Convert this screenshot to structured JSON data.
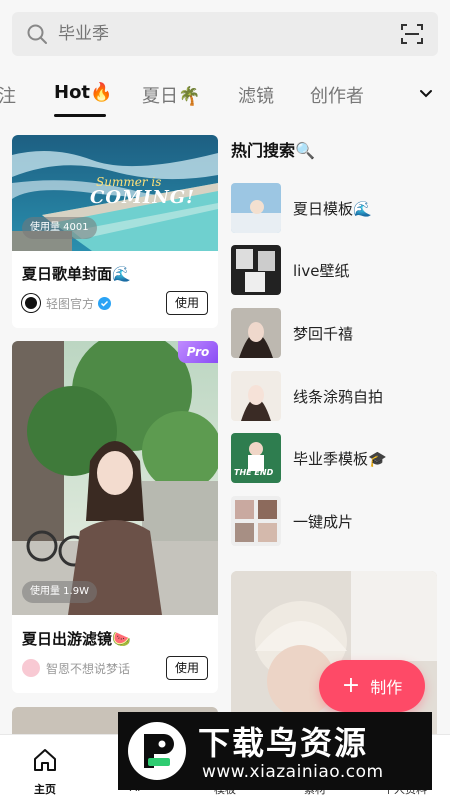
{
  "search": {
    "placeholder": "毕业季"
  },
  "tabs": [
    {
      "label": "注"
    },
    {
      "label": "Hot🔥"
    },
    {
      "label": "夏日🌴"
    },
    {
      "label": "滤镜"
    },
    {
      "label": "创作者"
    }
  ],
  "feed": {
    "cards": [
      {
        "usage": "使用量 4001",
        "title": "夏日歌单封面🌊",
        "author": "轻图官方",
        "button": "使用",
        "image_text_1": "Summer is",
        "image_text_2": "COMING!"
      },
      {
        "badge": "Pro",
        "usage": "使用量 1.9W",
        "title": "夏日出游滤镜🍉",
        "author": "智恩不想说梦话",
        "button": "使用"
      }
    ]
  },
  "hot_search": {
    "title": "热门搜索🔍",
    "items": [
      {
        "label": "夏日模板🌊"
      },
      {
        "label": "live壁纸"
      },
      {
        "label": "梦回千禧"
      },
      {
        "label": "线条涂鸦自拍"
      },
      {
        "label": "毕业季模板🎓",
        "thumb_text": "THE END"
      },
      {
        "label": "一键成片"
      }
    ]
  },
  "fab": {
    "label": "制作"
  },
  "bottom_nav": [
    {
      "label": "主页"
    },
    {
      "label": "AI"
    },
    {
      "label": "模板"
    },
    {
      "label": "素材"
    },
    {
      "label": "个人资料"
    }
  ],
  "watermark": {
    "title": "下载鸟资源",
    "url": "www.xiazainiao.com"
  },
  "colors": {
    "accent": "#fe4a67",
    "verified": "#2aa3f5",
    "pro": "#8a4df5"
  }
}
